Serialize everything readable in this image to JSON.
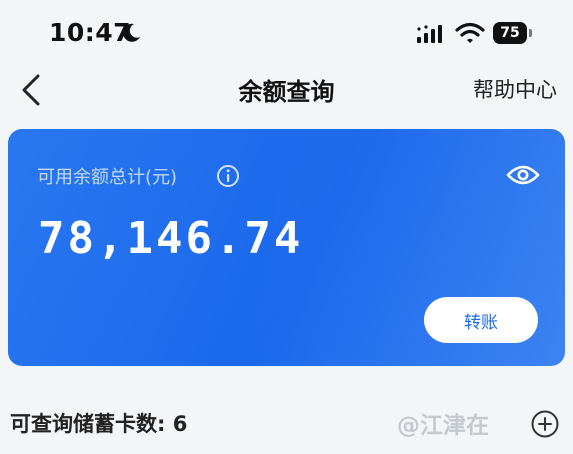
{
  "status_bar": {
    "time": "10:47",
    "battery_level": "75",
    "icons": [
      "moon-icon",
      "signal-icon",
      "wifi-icon",
      "battery-icon"
    ]
  },
  "header": {
    "title": "余额查询",
    "help_label": "帮助中心",
    "back_icon": "chevron-left-icon"
  },
  "balance_card": {
    "label": "可用余额总计(元)",
    "amount": "78,146.74",
    "transfer_label": "转账",
    "icons": [
      "info-icon",
      "eye-icon"
    ],
    "colors": {
      "card_blue": "#1f6bed",
      "button_text": "#1f6bed"
    }
  },
  "cards_section": {
    "count_label": "可查询储蓄卡数: 6",
    "add_icon": "add-circle-icon"
  },
  "watermark": {
    "text": "@江津在"
  }
}
